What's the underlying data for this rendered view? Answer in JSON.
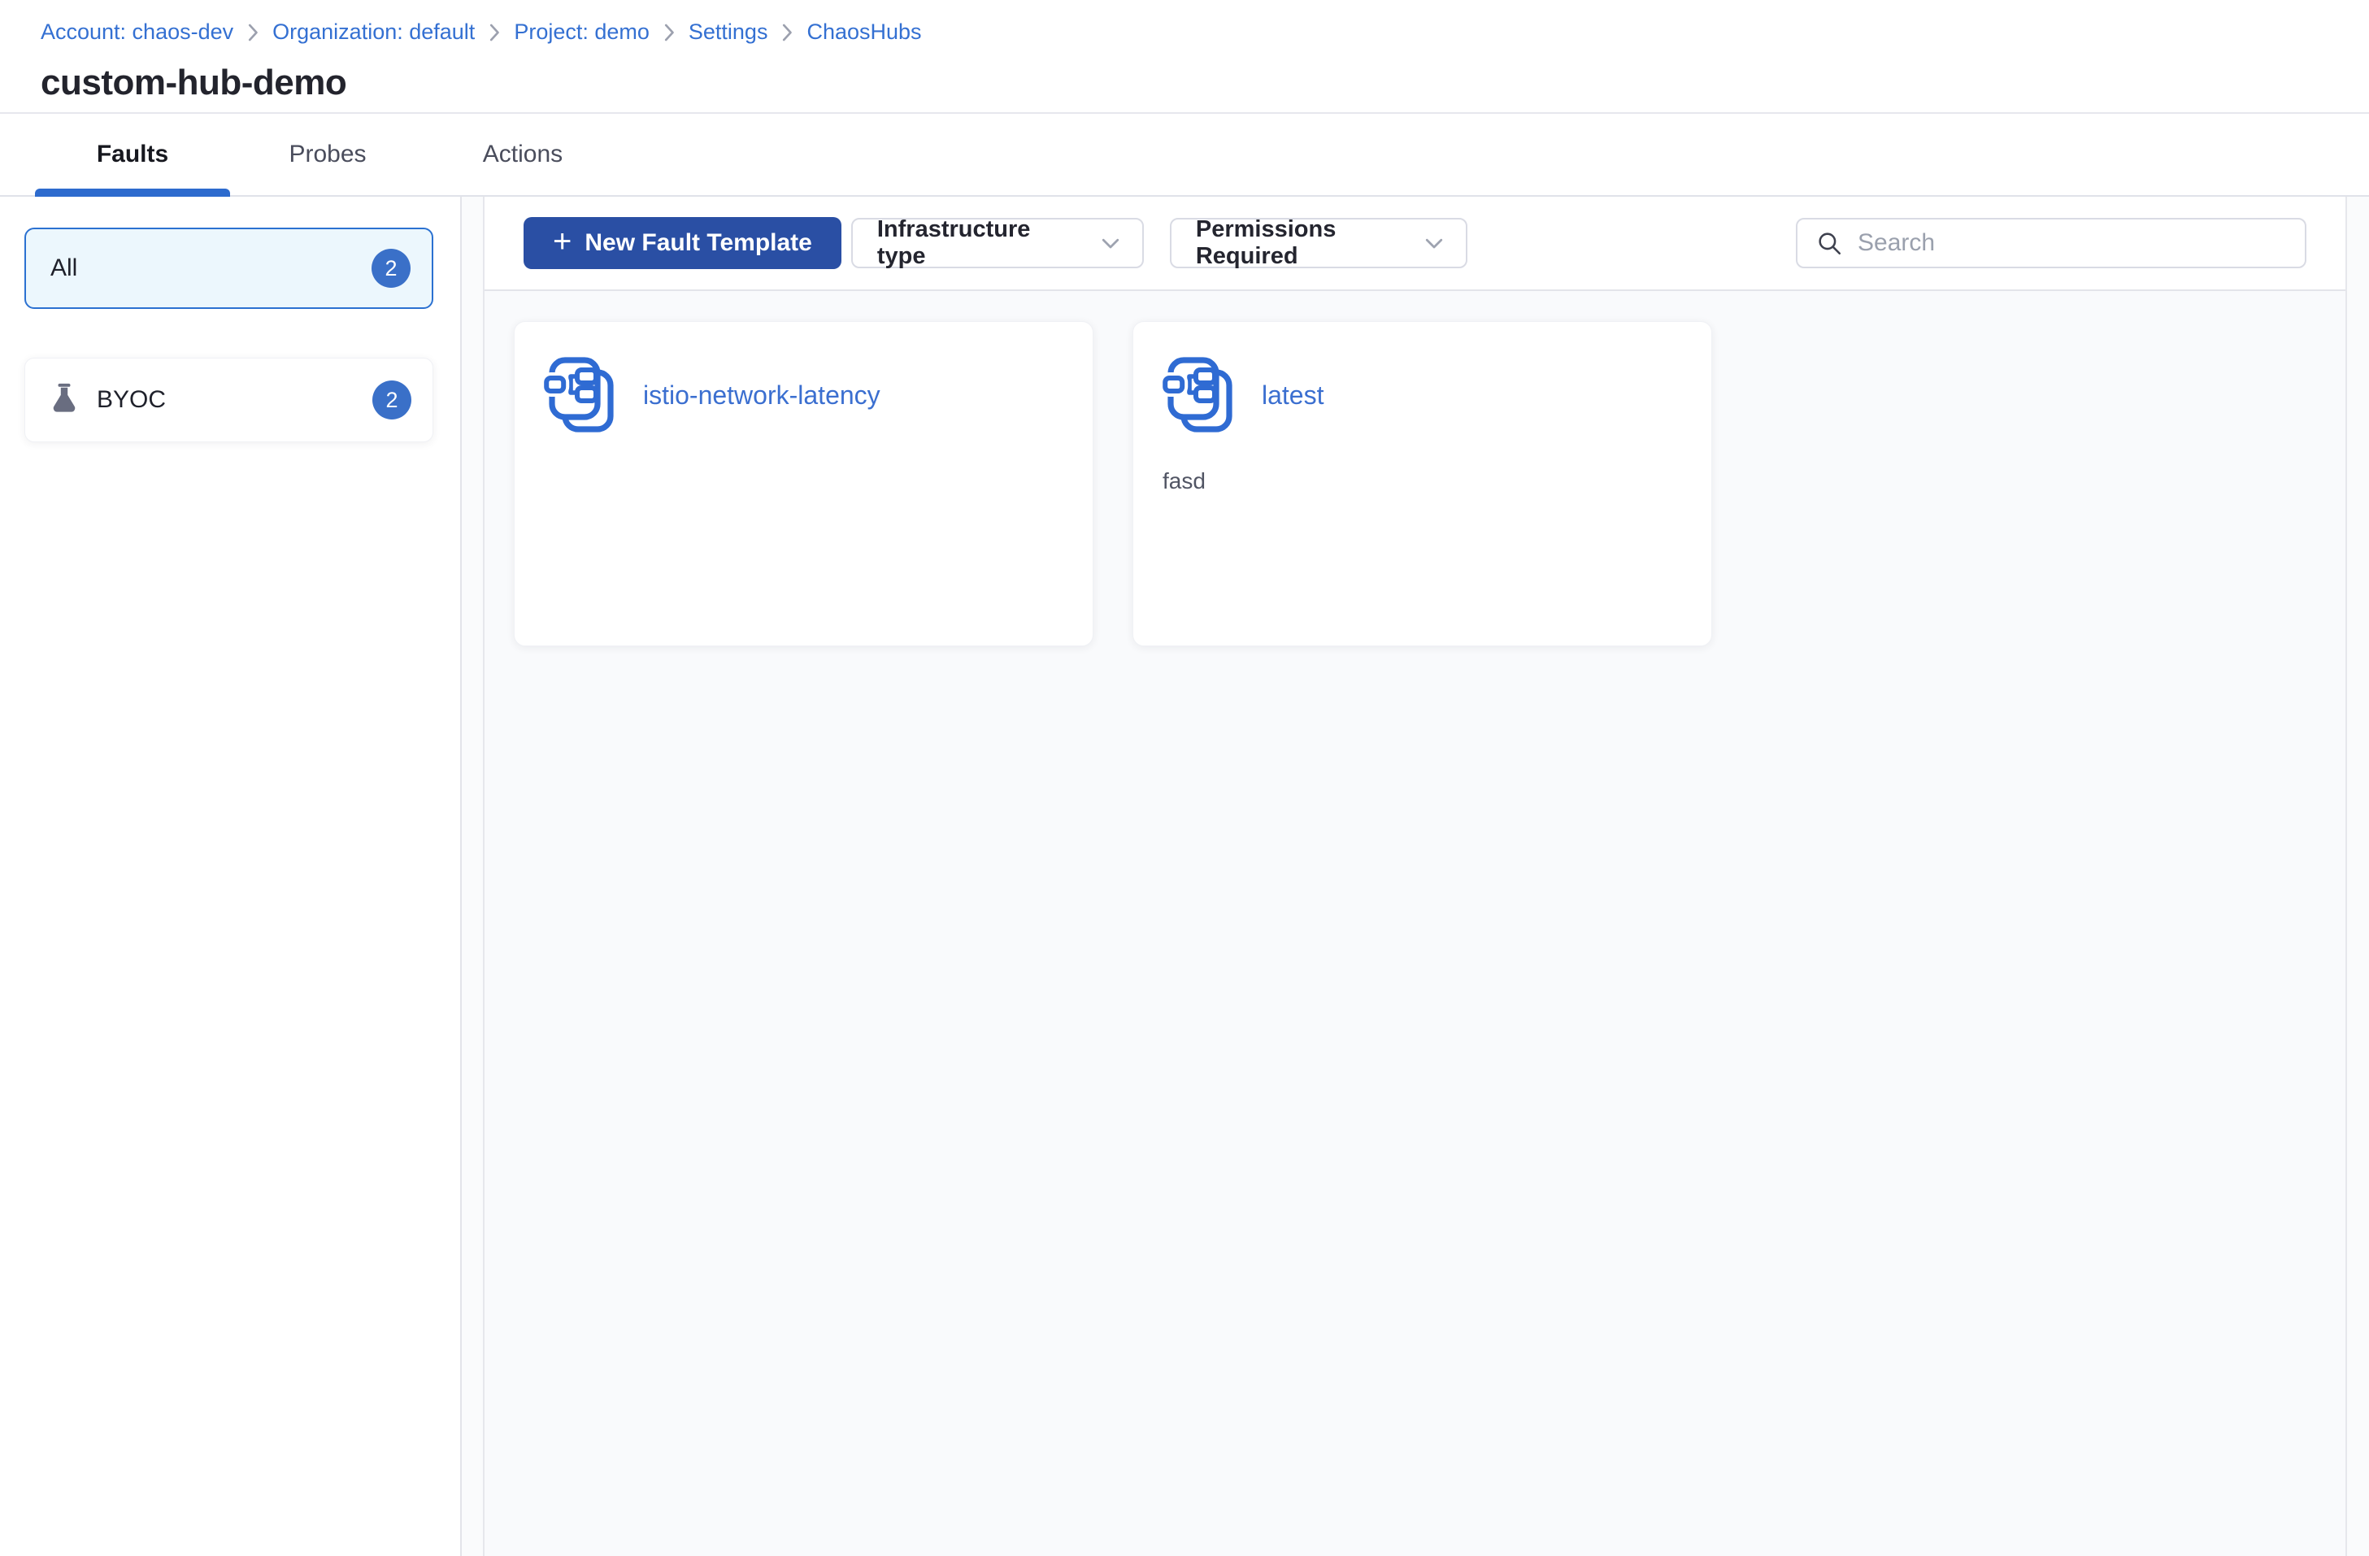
{
  "breadcrumb": {
    "separator_icon": "chevron-right-icon",
    "items": [
      {
        "label": "Account: chaos-dev"
      },
      {
        "label": "Organization: default"
      },
      {
        "label": "Project: demo"
      },
      {
        "label": "Settings"
      },
      {
        "label": "ChaosHubs"
      }
    ]
  },
  "page": {
    "title": "custom-hub-demo"
  },
  "tabs": [
    {
      "label": "Faults",
      "active": true
    },
    {
      "label": "Probes",
      "active": false
    },
    {
      "label": "Actions",
      "active": false
    }
  ],
  "sidebar": {
    "filters": [
      {
        "label": "All",
        "count": "2",
        "selected": true,
        "icon": null
      },
      {
        "label": "BYOC",
        "count": "2",
        "selected": false,
        "icon": "flask-icon"
      }
    ]
  },
  "toolbar": {
    "new_fault_template": {
      "plus": "+",
      "label": "New Fault Template"
    },
    "infrastructure_filter": {
      "label": "Infrastructure type"
    },
    "permissions_filter": {
      "label": "Permissions Required"
    },
    "search": {
      "placeholder": "Search",
      "value": ""
    }
  },
  "faults": {
    "cards": [
      {
        "title": "istio-network-latency",
        "description": ""
      },
      {
        "title": "latest",
        "description": "fasd"
      }
    ]
  },
  "colors": {
    "primary_button": "#2a4fa4",
    "badge_blue": "#3a70c8",
    "link_blue": "#3470d2",
    "card_title_blue": "#3b6fd0",
    "tab_underline": "#2d6bce",
    "selected_filter_bg": "#ecf7fd",
    "selected_filter_border": "#2b71d1",
    "content_bg": "#f9fafc"
  }
}
